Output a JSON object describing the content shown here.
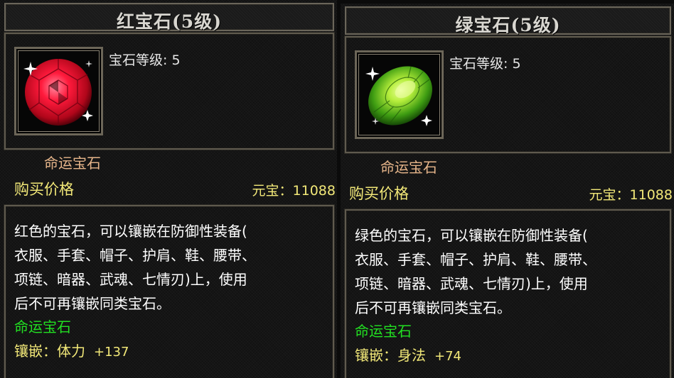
{
  "tooltips": [
    {
      "title": "红宝石(5级)",
      "gem_level_label": "宝石等级",
      "gem_level_value": "5",
      "gem_type": "命运宝石",
      "buy_label": "购买价格",
      "price_label": "元宝：",
      "price_value": "11088",
      "desc_line1": "红色的宝石，可以镶嵌在防御性装备(",
      "desc_line2": "衣服、手套、帽子、护肩、鞋、腰带、",
      "desc_line3": "项链、暗器、武魂、七情刃)上，使用",
      "desc_line4": "后不可再镶嵌同类宝石。",
      "desc_type": "命运宝石",
      "inlay_label": "镶嵌：",
      "inlay_stat": "体力",
      "inlay_value": "+137",
      "gem_color": "#e0102a",
      "gem_icon": "red-gem-icon"
    },
    {
      "title": "绿宝石(5级)",
      "gem_level_label": "宝石等级",
      "gem_level_value": "5",
      "gem_type": "命运宝石",
      "buy_label": "购买价格",
      "price_label": "元宝：",
      "price_value": "11088",
      "desc_line1": "绿色的宝石，可以镶嵌在防御性装备(",
      "desc_line2": "衣服、手套、帽子、护肩、鞋、腰带、",
      "desc_line3": "项链、暗器、武魂、七情刃)上，使用",
      "desc_line4": "后不可再镶嵌同类宝石。",
      "desc_type": "命运宝石",
      "inlay_label": "镶嵌：",
      "inlay_stat": "身法",
      "inlay_value": "+74",
      "gem_color": "#58c21a",
      "gem_icon": "green-gem-icon"
    }
  ]
}
